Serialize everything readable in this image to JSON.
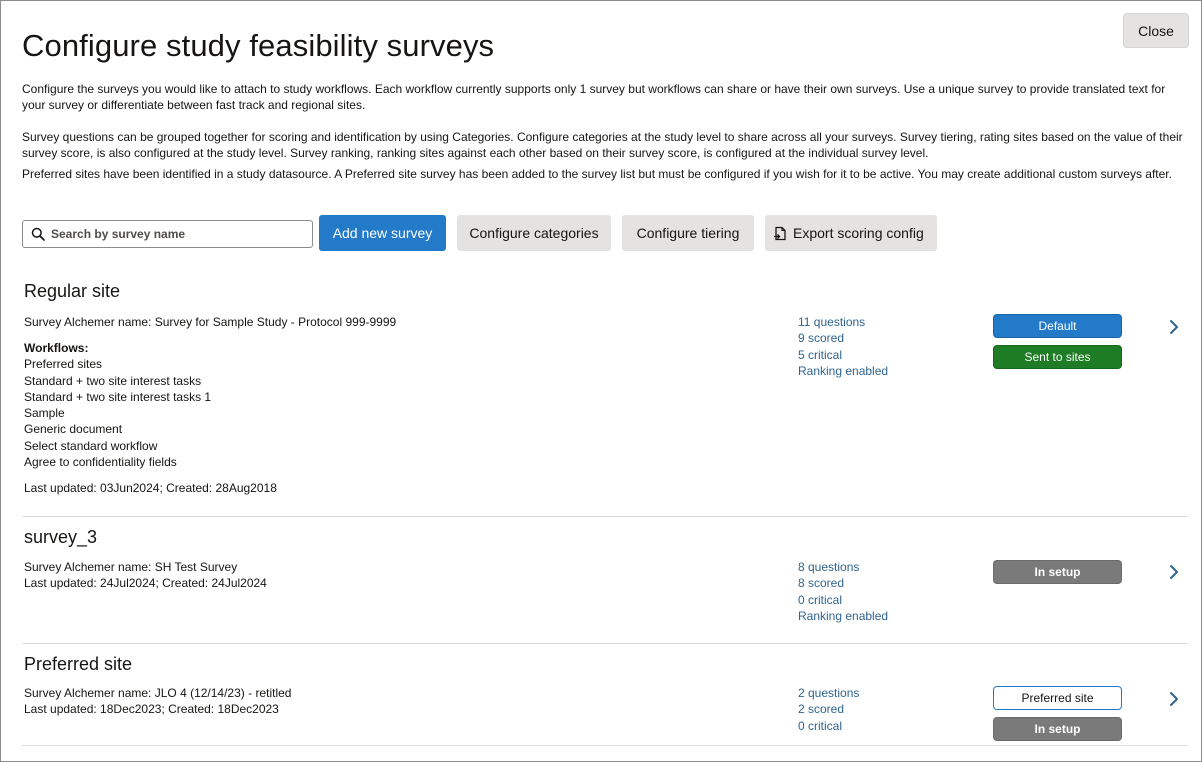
{
  "header": {
    "title": "Configure study feasibility surveys",
    "close_label": "Close"
  },
  "intro": {
    "p1": "Configure the surveys you would like to attach to study workflows. Each workflow currently supports only 1 survey but workflows can share or have their own surveys. Use a unique survey to provide translated text for your survey or differentiate between fast track and regional sites.",
    "p2": "Survey questions can be grouped together for scoring and identification by using Categories. Configure categories at the study level to share across all your surveys. Survey tiering, rating sites based on the value of their survey score, is also configured at the study level. Survey ranking, ranking sites against each other based on their survey score, is configured at the individual survey level.",
    "p3": "Preferred sites have been identified in a study datasource. A Preferred site survey has been added to the survey list but must be configured if you wish for it to be active. You may create additional custom surveys after."
  },
  "toolbar": {
    "search_placeholder": "Search by survey name",
    "search_value": "",
    "add_label": "Add new survey",
    "categories_label": "Configure categories",
    "tiering_label": "Configure tiering",
    "export_label": "Export scoring config"
  },
  "icons": {
    "search": "search-icon",
    "export": "export-icon",
    "chevron": "chevron-right-icon"
  },
  "colors": {
    "primary": "#227ac8",
    "success": "#1e7c24",
    "neutral": "#7a7a7a",
    "link": "#30648e"
  },
  "surveys": [
    {
      "title": "Regular site",
      "alchemer": "Survey Alchemer name: Survey for Sample Study - Protocol 999-9999",
      "workflows_label": "Workflows:",
      "workflows": [
        "Preferred sites",
        "Standard + two site interest tasks",
        "Standard + two site interest tasks 1",
        "Sample",
        "Generic document",
        "Select standard workflow",
        "Agree to confidentiality fields"
      ],
      "updated": "Last updated: 03Jun2024; Created: 28Aug2018",
      "stats": [
        "11 questions",
        "9 scored",
        "5 critical",
        "Ranking enabled"
      ],
      "badges": [
        "Default",
        "Sent to sites"
      ]
    },
    {
      "title": "survey_3",
      "alchemer": "Survey Alchemer name: SH Test Survey",
      "updated": "Last updated: 24Jul2024; Created: 24Jul2024",
      "stats": [
        "8 questions",
        "8 scored",
        "0 critical",
        "Ranking enabled"
      ],
      "badges": [
        "In setup"
      ]
    },
    {
      "title": "Preferred site",
      "alchemer": "Survey Alchemer name: JLO 4 (12/14/23) - retitled",
      "updated": "Last updated: 18Dec2023; Created: 18Dec2023",
      "stats": [
        "2 questions",
        "2 scored",
        "0 critical"
      ],
      "badges": [
        "Preferred site",
        "In setup"
      ]
    }
  ]
}
